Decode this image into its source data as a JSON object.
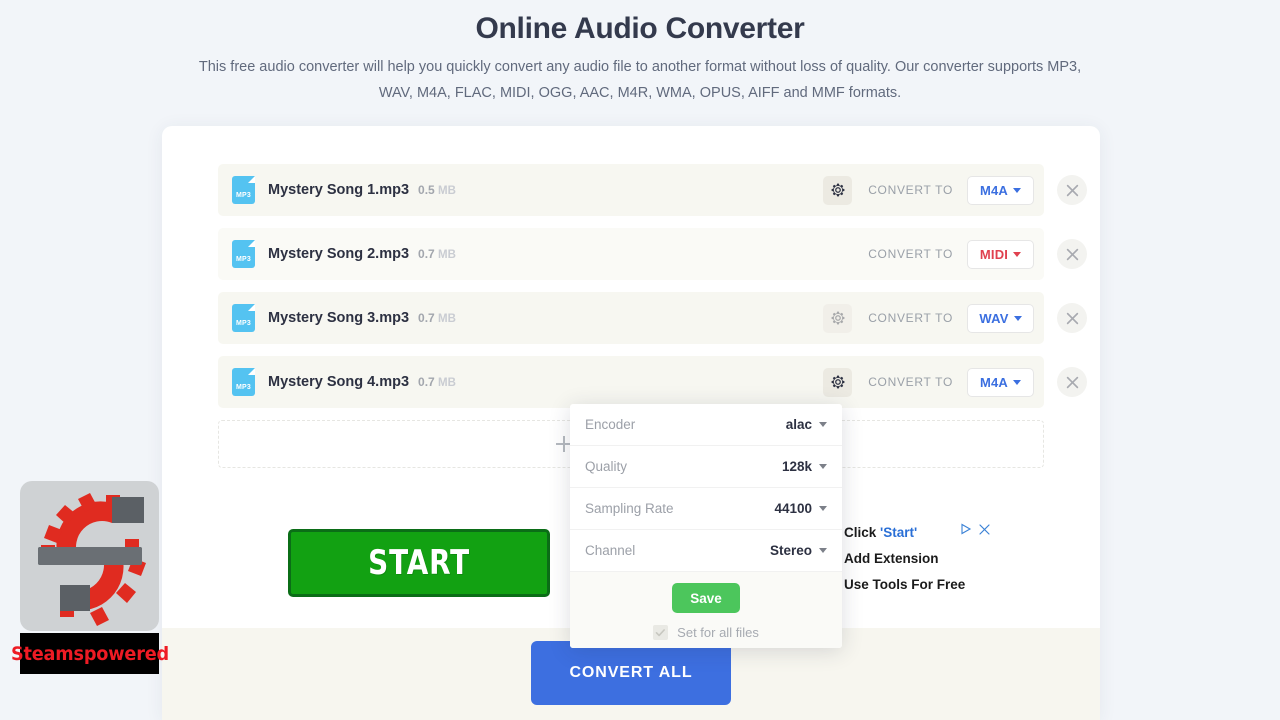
{
  "header": {
    "title": "Online Audio Converter",
    "description": "This free audio converter will help you quickly convert any audio file to another format without loss of quality. Our converter supports MP3, WAV, M4A, FLAC, MIDI, OGG, AAC, M4R, WMA, OPUS, AIFF and MMF formats."
  },
  "files": [
    {
      "icon_label": "MP3",
      "name": "Mystery Song 1.mp3",
      "size_value": "0.5",
      "size_unit": "MB",
      "gear_icon": "gear-icon",
      "convert_label": "CONVERT TO",
      "format": "M4A",
      "format_color": "#3b6fe0",
      "has_gear": true,
      "gear_state": "active",
      "remove_icon": "close-icon"
    },
    {
      "icon_label": "MP3",
      "name": "Mystery Song 2.mp3",
      "size_value": "0.7",
      "size_unit": "MB",
      "gear_icon": "gear-icon",
      "convert_label": "CONVERT TO",
      "format": "MIDI",
      "format_color": "#e0414f",
      "has_gear": false,
      "gear_state": "none",
      "remove_icon": "close-icon"
    },
    {
      "icon_label": "MP3",
      "name": "Mystery Song 3.mp3",
      "size_value": "0.7",
      "size_unit": "MB",
      "gear_icon": "gear-icon",
      "convert_label": "CONVERT TO",
      "format": "WAV",
      "format_color": "#3b6fe0",
      "has_gear": true,
      "gear_state": "dim",
      "remove_icon": "close-icon"
    },
    {
      "icon_label": "MP3",
      "name": "Mystery Song 4.mp3",
      "size_value": "0.7",
      "size_unit": "MB",
      "gear_icon": "gear-icon",
      "convert_label": "CONVERT TO",
      "format": "M4A",
      "format_color": "#3b6fe0",
      "has_gear": true,
      "gear_state": "active",
      "remove_icon": "close-icon"
    }
  ],
  "dropzone": {
    "add_icon": "plus-icon"
  },
  "settings_popup": {
    "rows": [
      {
        "label": "Encoder",
        "value": "alac"
      },
      {
        "label": "Quality",
        "value": "128k"
      },
      {
        "label": "Sampling Rate",
        "value": "44100"
      },
      {
        "label": "Channel",
        "value": "Stereo"
      }
    ],
    "save_label": "Save",
    "set_all_label": "Set for all files",
    "set_all_checked": true,
    "save_color": "#4cc65c"
  },
  "convert_all": {
    "label": "CONVERT ALL",
    "color": "#3d6fe0"
  },
  "ads": {
    "start_button": {
      "label": "START",
      "color": "#12a112"
    },
    "promo": {
      "line1_prefix": "Click ",
      "line1_highlight": "'Start'",
      "line2": "Add Extension",
      "line3": "Use Tools For Free",
      "adchoices_icon": "adchoices-triangle-icon",
      "close_icon": "close-icon"
    },
    "steam": {
      "name": "Steamspowered",
      "logo_icon": "gear-wrench-logo-icon"
    }
  }
}
